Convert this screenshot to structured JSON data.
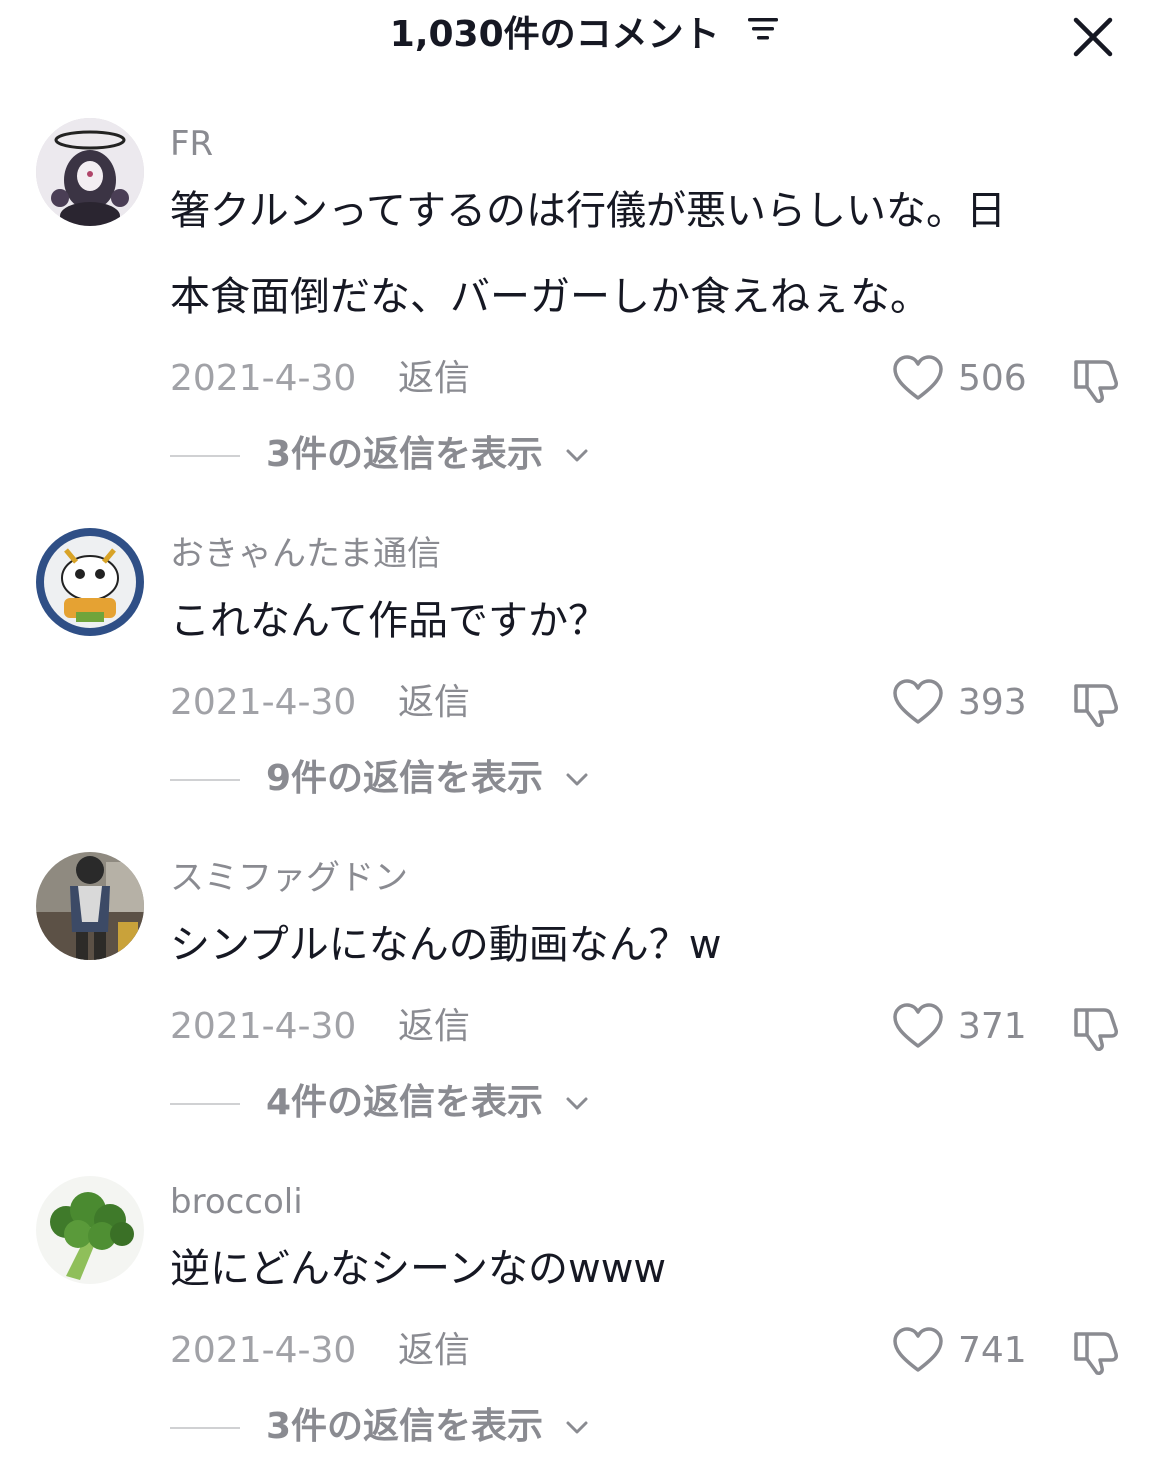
{
  "header": {
    "title": "1,030件のコメント"
  },
  "comments": [
    {
      "username": "FR",
      "text_line1": "箸クルンってするのは行儀が悪いらしいな。日",
      "text_line2": "本食面倒だな、バーガーしか食えねぇな。",
      "date": "2021-4-30",
      "reply_label": "返信",
      "likes": "506",
      "view_replies": "3件の返信を表示"
    },
    {
      "username": "おきゃんたま通信",
      "text_line1": "これなんて作品ですか？",
      "date": "2021-4-30",
      "reply_label": "返信",
      "likes": "393",
      "view_replies": "9件の返信を表示"
    },
    {
      "username": "スミファグドン",
      "text_line1": "シンプルになんの動画なん？w",
      "date": "2021-4-30",
      "reply_label": "返信",
      "likes": "371",
      "view_replies": "4件の返信を表示"
    },
    {
      "username": "broccoli",
      "text_line1": "逆にどんなシーンなのwww",
      "date": "2021-4-30",
      "reply_label": "返信",
      "likes": "741",
      "view_replies": "3件の返信を表示"
    }
  ],
  "icons": {
    "sort": "sort-icon",
    "close": "close-icon",
    "like": "heart-outline-icon",
    "dislike": "thumbs-down-icon",
    "expand": "chevron-down-icon"
  },
  "colors": {
    "text_primary": "#161823",
    "text_secondary": "#8a8b91",
    "text_tertiary": "#a1a2a7"
  }
}
